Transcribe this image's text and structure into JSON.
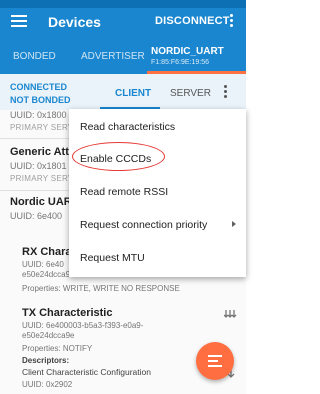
{
  "app": {
    "title": "Devices",
    "disconnect_label": "DISCONNECT"
  },
  "device_tabs": {
    "bonded": "BONDED",
    "advertiser": "ADVERTISER",
    "active_name": "NORDIC_UART",
    "active_mac": "F1:85:F6:9E:19:56"
  },
  "connection": {
    "state": "CONNECTED",
    "bond_state": "NOT BONDED",
    "client_tab": "CLIENT",
    "server_tab": "SERVER"
  },
  "services": [
    {
      "uuid": "UUID: 0x1800",
      "type": "PRIMARY SERVICE"
    },
    {
      "name": "Generic Att",
      "uuid": "UUID: 0x1801",
      "type": "PRIMARY SERVICE"
    },
    {
      "name": "Nordic UART",
      "uuid": "UUID: 6e400"
    }
  ],
  "characteristics": [
    {
      "name": "RX Characte",
      "uuid_line1": "UUID: 6e40",
      "uuid_line2": "e50e24dcca9e",
      "properties": "Properties: WRITE, WRITE NO RESPONSE"
    },
    {
      "name": "TX Characteristic",
      "uuid_line1": "UUID: 6e400003-b5a3-f393-e0a9-",
      "uuid_line2": "e50e24dcca9e",
      "properties": "Properties: NOTIFY",
      "descriptors_label": "Descriptors:",
      "descriptor_name": "Client Characteristic Configuration",
      "descriptor_uuid": "UUID: 0x2902"
    }
  ],
  "overflow_menu": {
    "items": [
      "Read characteristics",
      "Enable CCCDs",
      "Read remote RSSI",
      "Request connection priority",
      "Request MTU"
    ]
  },
  "colors": {
    "primary": "#1a86cf",
    "accent": "#ff6e40",
    "highlight_circle": "#e53935"
  },
  "icons": {
    "menu": "hamburger-icon",
    "overflow": "more-vert-icon",
    "fab": "list-icon",
    "write": "write-arrows-icon",
    "notify": "notify-arrows-icon",
    "submenu": "chevron-right-icon"
  }
}
